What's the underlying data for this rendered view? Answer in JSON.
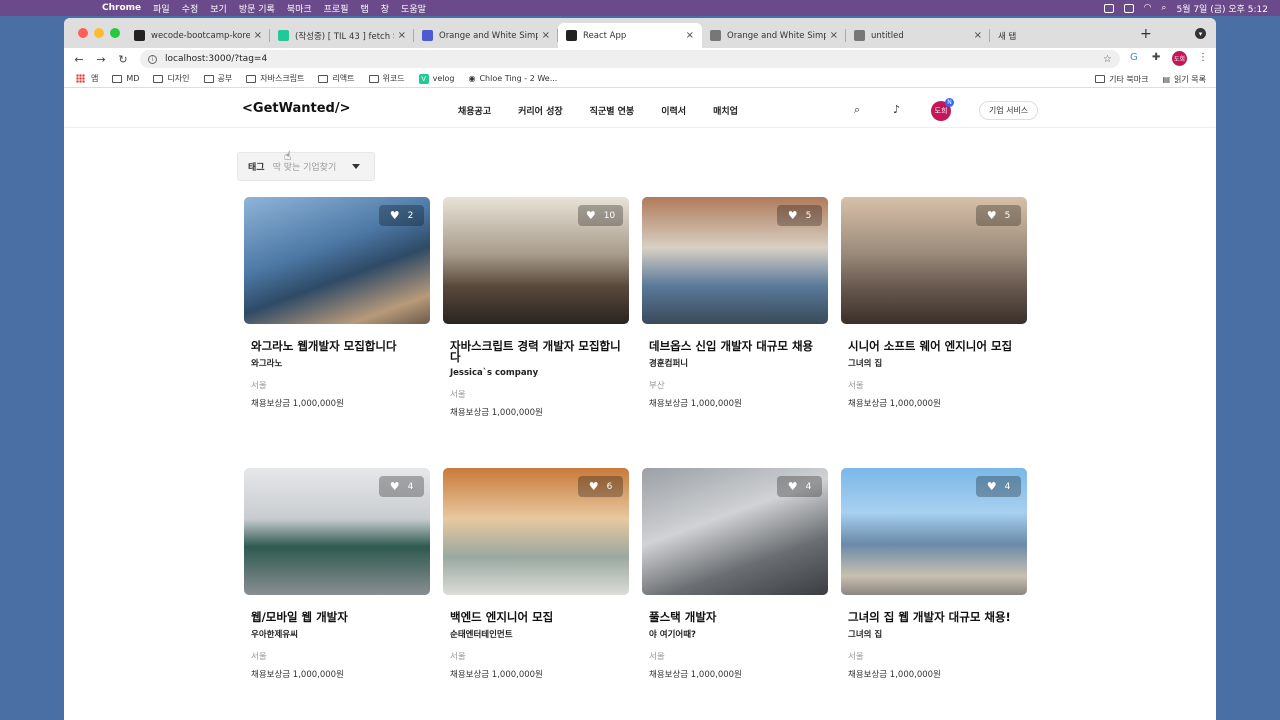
{
  "menubar": {
    "app": "Chrome",
    "items": [
      "파일",
      "수정",
      "보기",
      "방문 기록",
      "북마크",
      "프로필",
      "탭",
      "창",
      "도움말"
    ],
    "clock": "5월 7일 (금) 오후 5:12"
  },
  "tabs": [
    {
      "title": "wecode-bootcamp-korea",
      "fav": "github-icon",
      "color": "#222"
    },
    {
      "title": "(작성중) [ TIL 43 ] fetch 의",
      "fav": "velog-icon",
      "color": "#20c997"
    },
    {
      "title": "Orange and White Simple",
      "fav": "canva-icon",
      "color": "#4a5bd4"
    },
    {
      "title": "React App",
      "fav": "react-icon",
      "color": "#222",
      "active": true
    },
    {
      "title": "Orange and White Simple",
      "fav": "globe-icon",
      "color": "#777"
    },
    {
      "title": "untitled",
      "fav": "globe-icon",
      "color": "#777"
    },
    {
      "title": "새 탭",
      "fav": "",
      "color": ""
    }
  ],
  "address": {
    "url": "localhost:3000/?tag=4"
  },
  "bookmarks": {
    "items": [
      "앱",
      "MD",
      "디자인",
      "공부",
      "자바스크립트",
      "리액트",
      "위코드",
      "velog",
      "Chloe Ting - 2 We..."
    ],
    "right": [
      "기타 북마크",
      "읽기 목록"
    ]
  },
  "profile_initials": "도희",
  "site": {
    "logo": "<GetWanted/>",
    "nav": [
      "채용공고",
      "커리어 성장",
      "직군별 연봉",
      "이력서",
      "매치업"
    ],
    "avatar": "도희",
    "avatar_badge": "N",
    "biz_button": "기업 서비스",
    "tag_label": "태그",
    "tag_placeholder": "딱 맞는 기업찾기"
  },
  "cards": [
    {
      "title": "와그라노 웹개발자 모집합니다",
      "company": "와그라노",
      "location": "서울",
      "reward": "채용보상금 1,000,000원",
      "likes": "2"
    },
    {
      "title": "자바스크립트 경력 개발자 모집합니다",
      "company": "Jessica`s company",
      "location": "서울",
      "reward": "채용보상금 1,000,000원",
      "likes": "10"
    },
    {
      "title": "데브옵스 신입 개발자 대규모 채용",
      "company": "경훈컴퍼니",
      "location": "부산",
      "reward": "채용보상금 1,000,000원",
      "likes": "5"
    },
    {
      "title": "시니어 소프트 웨어 엔지니어 모집",
      "company": "그녀의 집",
      "location": "서울",
      "reward": "채용보상금 1,000,000원",
      "likes": "5"
    },
    {
      "title": "웹/모바일 웹 개발자",
      "company": "우아한제유씨",
      "location": "서울",
      "reward": "채용보상금 1,000,000원",
      "likes": "4"
    },
    {
      "title": "백엔드 엔지니어 모집",
      "company": "순태엔터테인먼트",
      "location": "서울",
      "reward": "채용보상금 1,000,000원",
      "likes": "6"
    },
    {
      "title": "풀스택 개발자",
      "company": "야 여기어때?",
      "location": "서울",
      "reward": "채용보상금 1,000,000원",
      "likes": "4"
    },
    {
      "title": "그녀의 집 웹 개발자 대규모 채용!",
      "company": "그녀의 집",
      "location": "서울",
      "reward": "채용보상금 1,000,000원",
      "likes": "4"
    }
  ],
  "colors": {
    "accent": "#3366ff",
    "avatar": "#c2185b"
  }
}
